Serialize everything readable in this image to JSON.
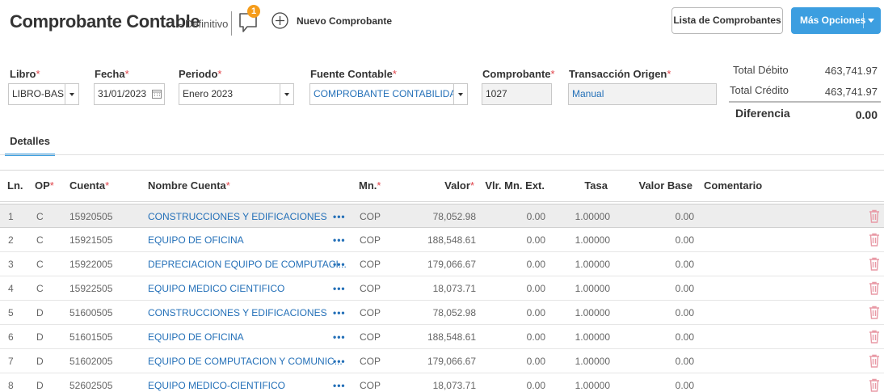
{
  "header": {
    "title": "Comprobante Contable",
    "status": "- Definitivo",
    "comment_count": "1",
    "new_label": "Nuevo Comprobante",
    "list_button": "Lista de Comprobantes",
    "more_button": "Más Opciones"
  },
  "form": {
    "libro": {
      "label": "Libro",
      "value": "LIBRO-BASE"
    },
    "fecha": {
      "label": "Fecha",
      "value": "31/01/2023"
    },
    "periodo": {
      "label": "Periodo",
      "value": "Enero 2023"
    },
    "fuente": {
      "label": "Fuente Contable",
      "value": "COMPROBANTE CONTABILIDAD"
    },
    "comprobante": {
      "label": "Comprobante",
      "value": "1027"
    },
    "transaccion": {
      "label": "Transacción Origen",
      "value": "Manual"
    },
    "required_mark": "*"
  },
  "totals": {
    "debit_label": "Total Débito",
    "debit_value": "463,741.97",
    "credit_label": "Total Crédito",
    "credit_value": "463,741.97",
    "diff_label": "Diferencia",
    "diff_value": "0.00"
  },
  "tabs": {
    "detalles": "Detalles"
  },
  "grid": {
    "headers": {
      "ln": "Ln.",
      "op": "OP",
      "cuenta": "Cuenta",
      "nombre": "Nombre Cuenta",
      "mn": "Mn.",
      "valor": "Valor",
      "vlr_ext": "Vlr. Mn. Ext.",
      "tasa": "Tasa",
      "valor_base": "Valor Base",
      "comentario": "Comentario"
    },
    "rows": [
      {
        "ln": "1",
        "op": "C",
        "cuenta": "15920505",
        "nombre": "CONSTRUCCIONES Y EDIFICACIONES",
        "dots": "•••",
        "mn": "COP",
        "valor": "78,052.98",
        "vlr_ext": "0.00",
        "tasa": "1.00000",
        "valor_base": "0.00"
      },
      {
        "ln": "2",
        "op": "C",
        "cuenta": "15921505",
        "nombre": "EQUIPO DE OFICINA",
        "dots": "•••",
        "mn": "COP",
        "valor": "188,548.61",
        "vlr_ext": "0.00",
        "tasa": "1.00000",
        "valor_base": "0.00"
      },
      {
        "ln": "3",
        "op": "C",
        "cuenta": "15922005",
        "nombre": "DEPRECIACION EQUIPO DE COMPUTACI...",
        "dots": "•••",
        "mn": "COP",
        "valor": "179,066.67",
        "vlr_ext": "0.00",
        "tasa": "1.00000",
        "valor_base": "0.00"
      },
      {
        "ln": "4",
        "op": "C",
        "cuenta": "15922505",
        "nombre": "EQUIPO MEDICO CIENTIFICO",
        "dots": "•••",
        "mn": "COP",
        "valor": "18,073.71",
        "vlr_ext": "0.00",
        "tasa": "1.00000",
        "valor_base": "0.00"
      },
      {
        "ln": "5",
        "op": "D",
        "cuenta": "51600505",
        "nombre": "CONSTRUCCIONES Y EDIFICACIONES",
        "dots": "•••",
        "mn": "COP",
        "valor": "78,052.98",
        "vlr_ext": "0.00",
        "tasa": "1.00000",
        "valor_base": "0.00"
      },
      {
        "ln": "6",
        "op": "D",
        "cuenta": "51601505",
        "nombre": "EQUIPO DE OFICINA",
        "dots": "•••",
        "mn": "COP",
        "valor": "188,548.61",
        "vlr_ext": "0.00",
        "tasa": "1.00000",
        "valor_base": "0.00"
      },
      {
        "ln": "7",
        "op": "D",
        "cuenta": "51602005",
        "nombre": "EQUIPO DE COMPUTACION Y COMUNIC...",
        "dots": "•••",
        "mn": "COP",
        "valor": "179,066.67",
        "vlr_ext": "0.00",
        "tasa": "1.00000",
        "valor_base": "0.00"
      },
      {
        "ln": "8",
        "op": "D",
        "cuenta": "52602505",
        "nombre": "EQUIPO MEDICO-CIENTIFICO",
        "dots": "•••",
        "mn": "COP",
        "valor": "18,073.71",
        "vlr_ext": "0.00",
        "tasa": "1.00000",
        "valor_base": "0.00"
      }
    ]
  },
  "colors": {
    "accent": "#3c9ee0",
    "link": "#2470b8",
    "required": "#e0444b",
    "badge": "#f59c1a",
    "trash": "#e89aa6"
  },
  "icons": {
    "comment": "comment-icon",
    "add": "plus-circle-icon",
    "calendar": "calendar-icon",
    "delete": "trash-icon",
    "more": "ellipsis-icon"
  }
}
